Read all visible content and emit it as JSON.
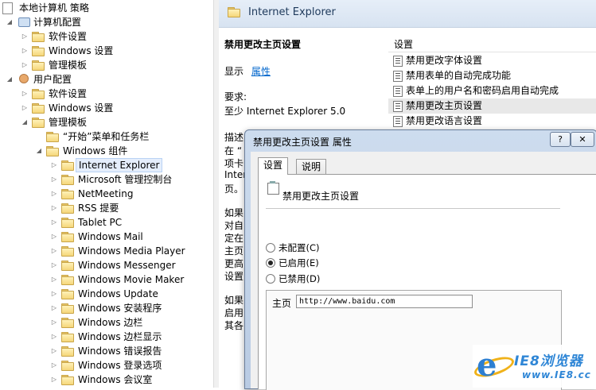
{
  "tree": {
    "root": "本地计算机 策略",
    "computer_config": "计算机配置",
    "user_config": "用户配置",
    "computer_children": [
      "软件设置",
      "Windows 设置",
      "管理模板"
    ],
    "user_children": [
      "软件设置",
      "Windows 设置",
      "管理模板"
    ],
    "admin_children": [
      "“开始”菜单和任务栏",
      "Windows 组件"
    ],
    "windows_components": [
      "Internet Explorer",
      "Microsoft 管理控制台",
      "NetMeeting",
      "RSS 提要",
      "Tablet PC",
      "Windows Mail",
      "Windows Media Player",
      "Windows Messenger",
      "Windows Movie Maker",
      "Windows Update",
      "Windows 安装程序",
      "Windows 边栏",
      "Windows 边栏显示",
      "Windows 错误报告",
      "Windows 登录选项",
      "Windows 会议室"
    ],
    "selected": "Internet Explorer"
  },
  "right": {
    "header_title": "Internet Explorer",
    "desc_title": "禁用更改主页设置",
    "show_label": "显示",
    "properties_link": "属性",
    "requirement_label": "要求:",
    "requirement_value": "至少 Internet Explorer 5.0",
    "desc_fragments": [
      "描述",
      "在 “",
      "项卡",
      "Intern",
      "页。",
      "如果",
      "对自",
      "定在",
      "主页",
      "更高",
      "设置",
      "如果",
      "启用",
      "其各"
    ],
    "settings_header": "设置",
    "settings_items": [
      "禁用更改字体设置",
      "禁用表单的自动完成功能",
      "表单上的用户名和密码启用自动完成",
      "禁用更改主页设置",
      "禁用更改语言设置"
    ],
    "settings_selected": "禁用更改主页设置"
  },
  "dialog": {
    "title": "禁用更改主页设置 属性",
    "help_label": "?",
    "close_label": "✕",
    "tabs": [
      "设置",
      "说明"
    ],
    "active_tab": "设置",
    "policy_name": "禁用更改主页设置",
    "options": [
      "未配置(C)",
      "已启用(E)",
      "已禁用(D)"
    ],
    "selected_option": "已启用(E)",
    "home_label": "主页",
    "home_value": "http://www.baidu.com"
  },
  "watermark": {
    "title": "IE8浏览器",
    "url": "www.IE8.cc"
  }
}
